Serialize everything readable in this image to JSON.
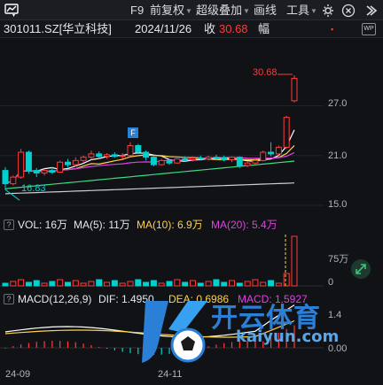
{
  "toolbar": {
    "f9": "F9",
    "adjust": "前复权",
    "overlay": "超级叠加",
    "draw": "画线",
    "tools": "工具"
  },
  "info": {
    "code": "301011.SZ[华立科技]",
    "date": "2024/11/26",
    "close_label": "收",
    "close_value": "30.68",
    "amplitude_label": "幅",
    "badge": "WP"
  },
  "price_axis": {
    "high_marker": "30.68",
    "low_marker": "16.83",
    "ticks": [
      "27.0",
      "21.0",
      "15.0"
    ]
  },
  "volume": {
    "label": "VOL: 16万",
    "ma5": "MA(5): 11万",
    "ma10": "MA(10): 6.9万",
    "ma20": "MA(20): 5.4万",
    "ticks": [
      "75万",
      "0"
    ]
  },
  "macd": {
    "label": "MACD(12,26,9)",
    "dif": "DIF: 1.4950",
    "dea": "DEA: 0.6986",
    "macd": "MACD: 1.5927",
    "ticks": [
      "1.4",
      "0.00"
    ]
  },
  "x_axis": [
    "24-09",
    "24-11"
  ],
  "watermark": {
    "title": "开云体育",
    "sub": "kaiyun.com"
  },
  "colors": {
    "up": "#ff3b3b",
    "down": "#00d0d0",
    "ma5": "#ffffff",
    "ma10": "#ffd24a",
    "ma20": "#e040e0",
    "ma60": "#3ddc84"
  },
  "chart_data": {
    "type": "candlestick",
    "ylim": [
      15,
      31
    ],
    "candles": [
      [
        19.2,
        19.6,
        16.9,
        17.6
      ],
      [
        17.6,
        18.6,
        17.4,
        18.4
      ],
      [
        18.4,
        21.8,
        18.2,
        21.4
      ],
      [
        21.4,
        21.6,
        18.8,
        19.2
      ],
      [
        19.2,
        19.5,
        18.4,
        18.9
      ],
      [
        18.9,
        19.4,
        18.6,
        19.2
      ],
      [
        19.2,
        19.6,
        18.8,
        19.0
      ],
      [
        19.0,
        20.4,
        18.9,
        20.2
      ],
      [
        20.2,
        20.6,
        19.6,
        19.9
      ],
      [
        19.9,
        20.8,
        19.7,
        20.4
      ],
      [
        20.4,
        21.0,
        20.1,
        20.8
      ],
      [
        20.8,
        21.6,
        20.5,
        21.2
      ],
      [
        21.2,
        21.5,
        20.6,
        20.9
      ],
      [
        20.9,
        21.3,
        20.6,
        21.1
      ],
      [
        21.1,
        21.4,
        20.7,
        20.9
      ],
      [
        20.9,
        21.3,
        20.6,
        21.0
      ],
      [
        21.0,
        22.6,
        20.9,
        22.2
      ],
      [
        22.2,
        22.4,
        21.2,
        21.4
      ],
      [
        21.4,
        21.6,
        20.4,
        20.8
      ],
      [
        20.8,
        20.9,
        19.7,
        19.9
      ],
      [
        19.9,
        20.6,
        19.8,
        20.4
      ],
      [
        20.4,
        20.6,
        19.9,
        20.1
      ],
      [
        20.1,
        20.7,
        20.0,
        20.6
      ],
      [
        20.6,
        20.9,
        20.3,
        20.5
      ],
      [
        20.5,
        20.9,
        20.3,
        20.7
      ],
      [
        20.7,
        21.0,
        20.4,
        20.6
      ],
      [
        20.6,
        21.0,
        20.4,
        20.8
      ],
      [
        20.8,
        21.1,
        20.5,
        20.7
      ],
      [
        20.7,
        21.0,
        20.3,
        20.5
      ],
      [
        20.5,
        20.9,
        20.2,
        20.8
      ],
      [
        20.8,
        20.9,
        19.5,
        19.8
      ],
      [
        19.8,
        20.3,
        19.6,
        20.1
      ],
      [
        20.1,
        20.6,
        19.9,
        20.4
      ],
      [
        20.4,
        21.6,
        20.3,
        21.4
      ],
      [
        21.4,
        22.6,
        20.9,
        21.2
      ],
      [
        21.2,
        22.2,
        21.0,
        22.0
      ],
      [
        22.0,
        25.8,
        21.8,
        25.6
      ],
      [
        27.6,
        30.68,
        27.4,
        30.3
      ]
    ]
  }
}
